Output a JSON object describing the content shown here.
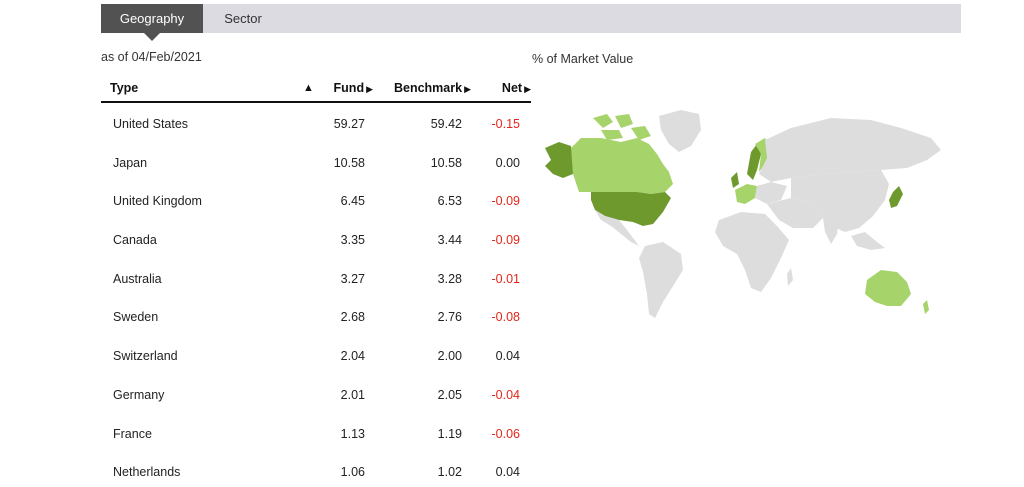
{
  "tabs": [
    {
      "label": "Geography",
      "active": true
    },
    {
      "label": "Sector",
      "active": false
    }
  ],
  "as_of": "as of 04/Feb/2021",
  "map_title": "% of Market Value",
  "table": {
    "headers": {
      "type": "Type",
      "sort_icon": "▲",
      "fund": "Fund",
      "benchmark": "Benchmark",
      "net": "Net",
      "arrow": "▶"
    },
    "rows": [
      {
        "type": "United States",
        "fund": "59.27",
        "benchmark": "59.42",
        "net": "-0.15",
        "negative": true
      },
      {
        "type": "Japan",
        "fund": "10.58",
        "benchmark": "10.58",
        "net": "0.00",
        "negative": false
      },
      {
        "type": "United Kingdom",
        "fund": "6.45",
        "benchmark": "6.53",
        "net": "-0.09",
        "negative": true
      },
      {
        "type": "Canada",
        "fund": "3.35",
        "benchmark": "3.44",
        "net": "-0.09",
        "negative": true
      },
      {
        "type": "Australia",
        "fund": "3.27",
        "benchmark": "3.28",
        "net": "-0.01",
        "negative": true
      },
      {
        "type": "Sweden",
        "fund": "2.68",
        "benchmark": "2.76",
        "net": "-0.08",
        "negative": true
      },
      {
        "type": "Switzerland",
        "fund": "2.04",
        "benchmark": "2.00",
        "net": "0.04",
        "negative": false
      },
      {
        "type": "Germany",
        "fund": "2.01",
        "benchmark": "2.05",
        "net": "-0.04",
        "negative": true
      },
      {
        "type": "France",
        "fund": "1.13",
        "benchmark": "1.19",
        "net": "-0.06",
        "negative": true
      },
      {
        "type": "Netherlands",
        "fund": "1.06",
        "benchmark": "1.02",
        "net": "0.04",
        "negative": false
      }
    ]
  },
  "colors": {
    "tab_active": "#525252",
    "tab_bar": "#dcdbe1",
    "negative": "#e3261b",
    "map_base": "#dddddd",
    "map_high": "#6e9a2d",
    "map_low": "#a6d46b"
  }
}
